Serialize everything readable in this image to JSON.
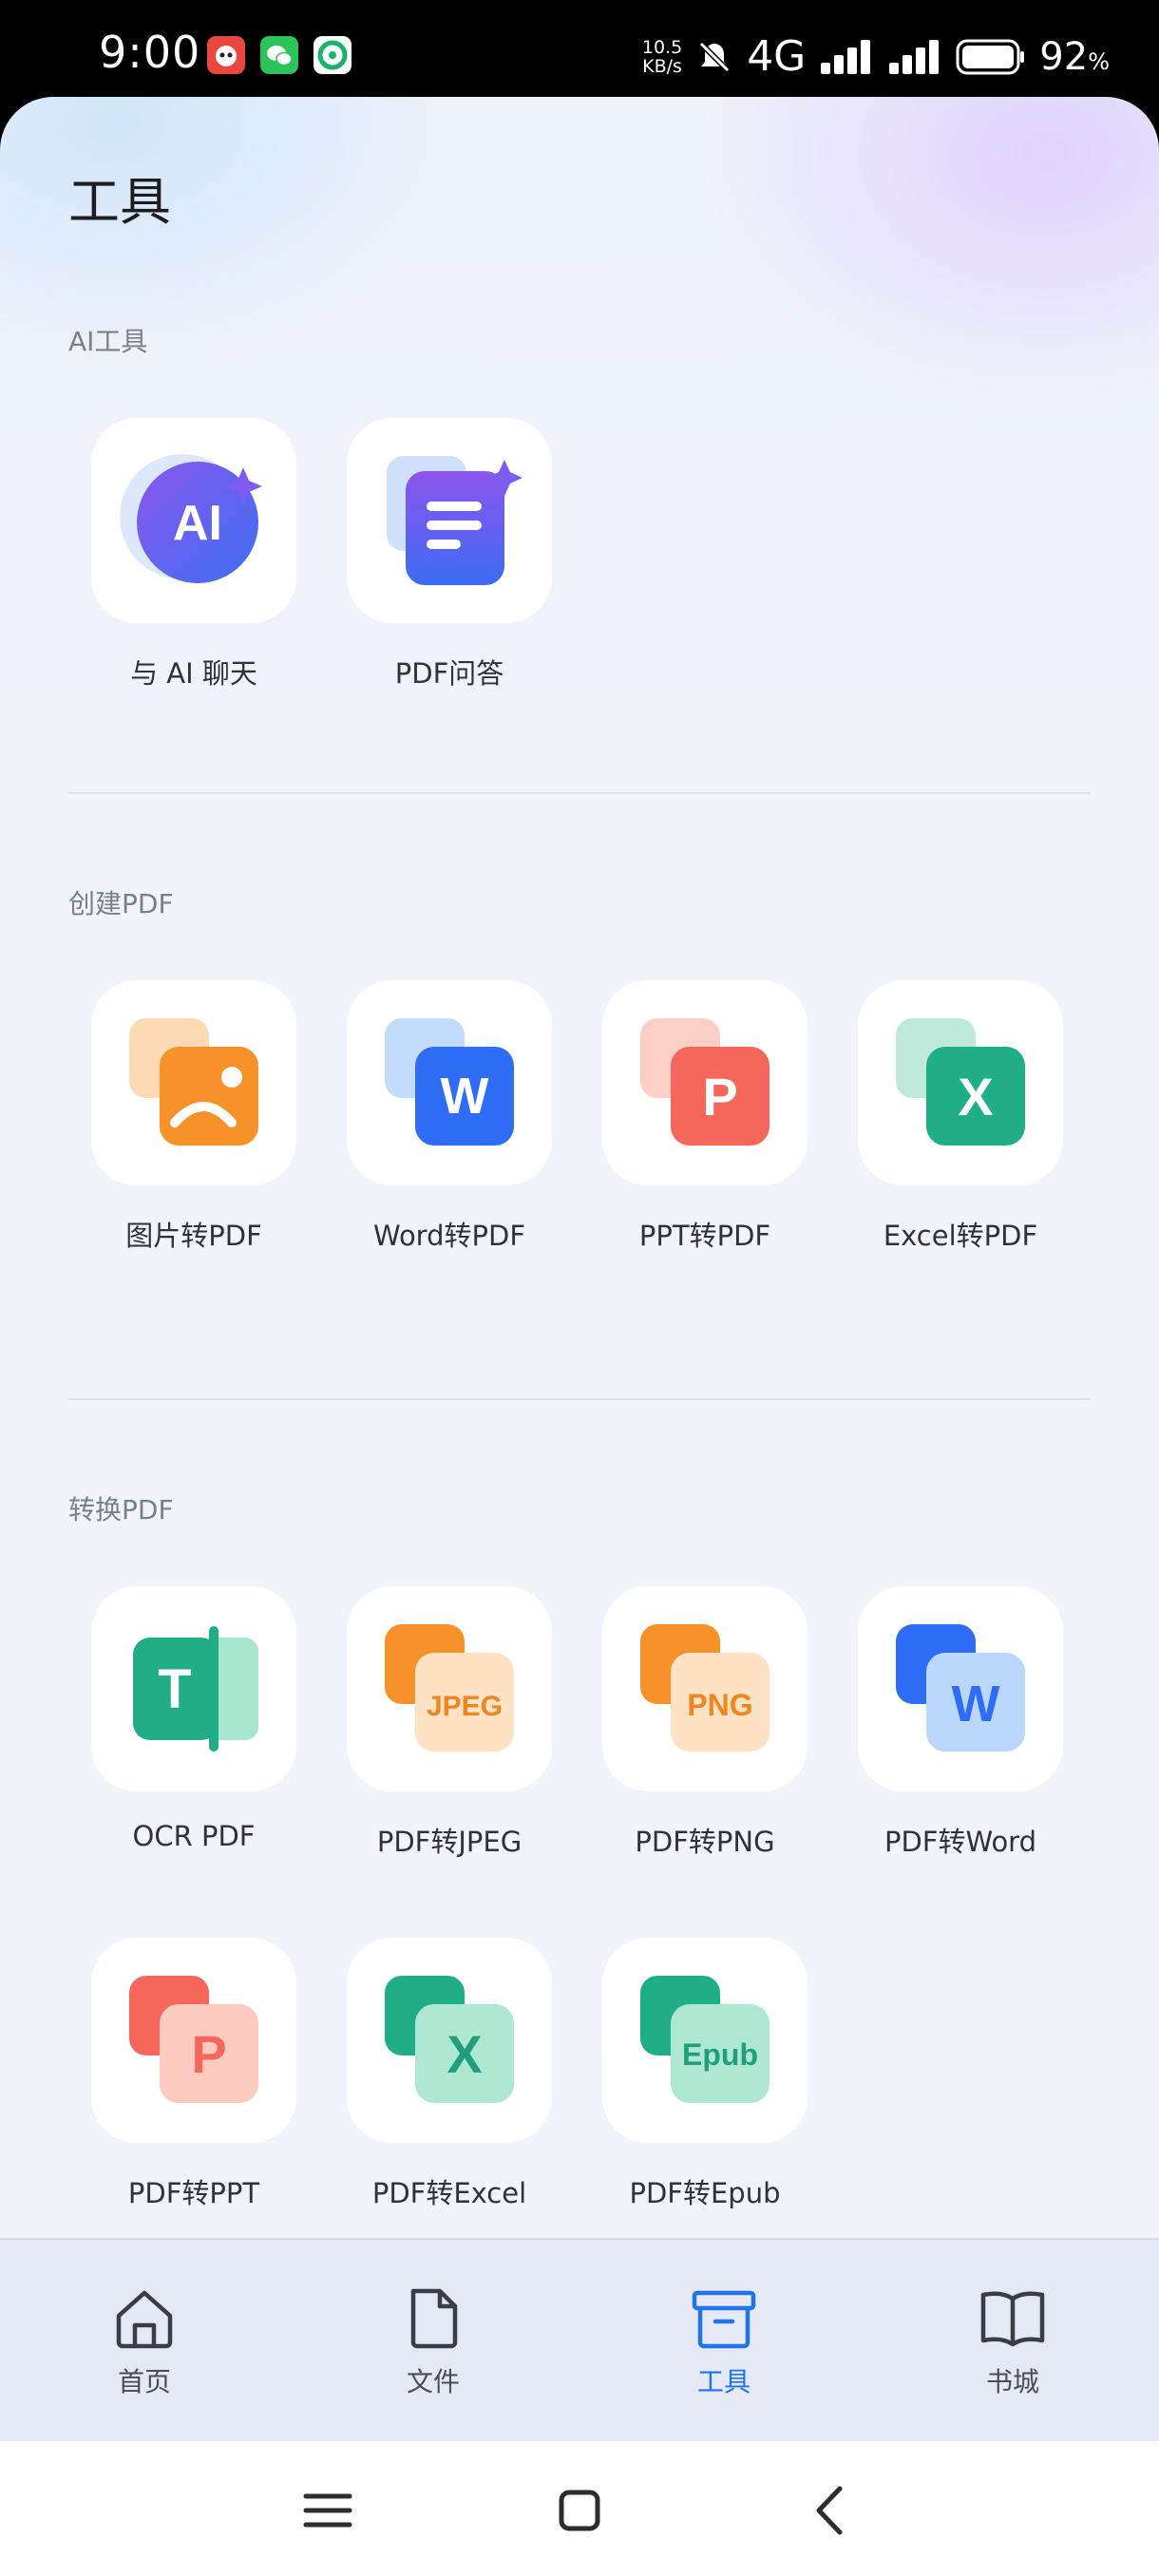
{
  "status_bar": {
    "time": "9:00",
    "network_speed_value": "10.5",
    "network_speed_unit": "KB/s",
    "network_type": "4G",
    "battery_percent": "92",
    "battery_unit": "%"
  },
  "page": {
    "title": "工具"
  },
  "sections": {
    "ai": {
      "label": "AI工具",
      "items": [
        {
          "label": "与 AI 聊天",
          "icon": "ai-chat-icon"
        },
        {
          "label": "PDF问答",
          "icon": "pdf-qa-icon"
        }
      ]
    },
    "create": {
      "label": "创建PDF",
      "items": [
        {
          "label": "图片转PDF",
          "icon": "image-icon"
        },
        {
          "label": "Word转PDF",
          "icon": "word-icon",
          "glyph": "W"
        },
        {
          "label": "PPT转PDF",
          "icon": "ppt-icon",
          "glyph": "P"
        },
        {
          "label": "Excel转PDF",
          "icon": "excel-icon",
          "glyph": "X"
        }
      ]
    },
    "convert": {
      "label": "转换PDF",
      "items": [
        {
          "label": "OCR PDF",
          "icon": "ocr-icon",
          "glyph": "T"
        },
        {
          "label": "PDF转JPEG",
          "icon": "jpeg-icon",
          "glyph": "JPEG"
        },
        {
          "label": "PDF转PNG",
          "icon": "png-icon",
          "glyph": "PNG"
        },
        {
          "label": "PDF转Word",
          "icon": "word-icon",
          "glyph": "W"
        },
        {
          "label": "PDF转PPT",
          "icon": "ppt-icon",
          "glyph": "P"
        },
        {
          "label": "PDF转Excel",
          "icon": "excel-icon",
          "glyph": "X"
        },
        {
          "label": "PDF转Epub",
          "icon": "epub-icon",
          "glyph": "Epub"
        }
      ]
    }
  },
  "ai_badge": "AI",
  "bottom_nav": {
    "items": [
      {
        "label": "首页",
        "icon": "home-icon"
      },
      {
        "label": "文件",
        "icon": "file-icon"
      },
      {
        "label": "工具",
        "icon": "toolbox-icon",
        "active": true
      },
      {
        "label": "书城",
        "icon": "book-icon"
      }
    ]
  },
  "colors": {
    "accent": "#1e74e8",
    "word_blue": "#2f6df6",
    "ppt_red": "#f4675a",
    "excel_green": "#1fae86",
    "orange": "#f7922a"
  }
}
